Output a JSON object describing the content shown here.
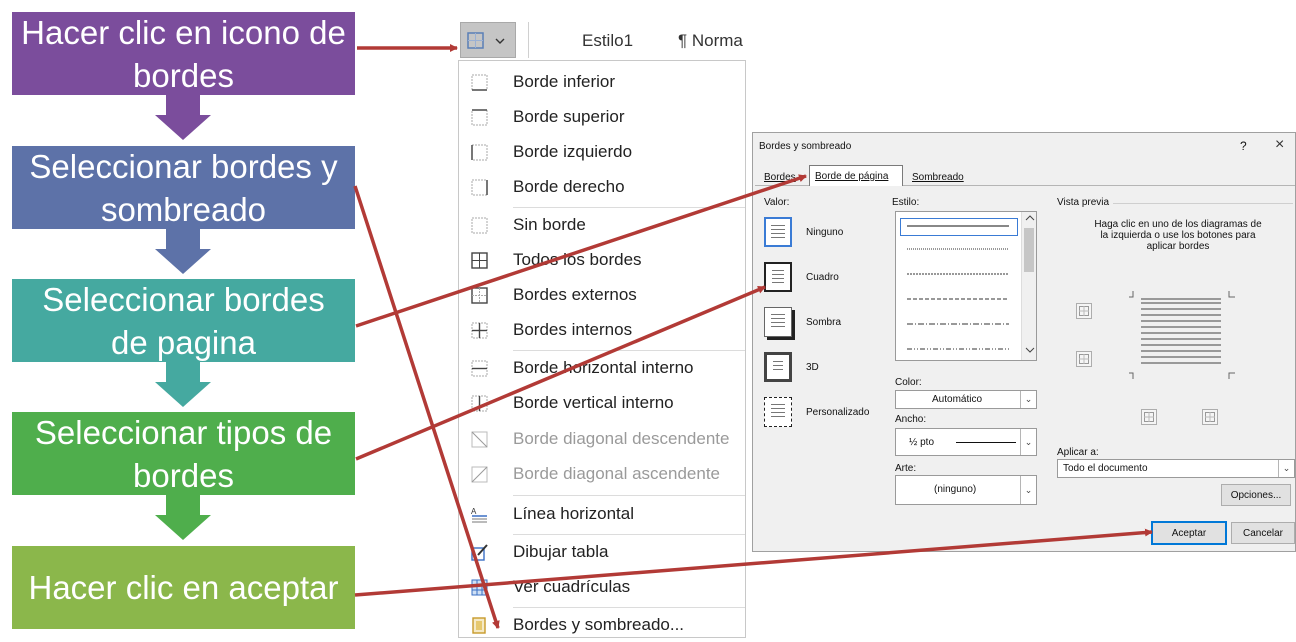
{
  "steps": [
    {
      "label": "Hacer clic en icono de bordes",
      "color": "#7b4d9c"
    },
    {
      "label": "Seleccionar bordes y sombreado",
      "color": "#5d72a8"
    },
    {
      "label": "Seleccionar bordes de pagina",
      "color": "#45a9a0"
    },
    {
      "label": "Seleccionar tipos de bordes",
      "color": "#4fae4c"
    },
    {
      "label": "Hacer clic en aceptar",
      "color": "#8bb74b"
    }
  ],
  "toolbar": {
    "style1": "Estilo1",
    "normal": "¶ Norma"
  },
  "menu": {
    "items": [
      {
        "label": "Borde inferior",
        "icon": "border-bottom-icon"
      },
      {
        "label": "Borde superior",
        "icon": "border-top-icon"
      },
      {
        "label": "Borde izquierdo",
        "icon": "border-left-icon"
      },
      {
        "label": "Borde derecho",
        "icon": "border-right-icon"
      },
      {
        "label": "Sin borde",
        "icon": "no-border-icon"
      },
      {
        "label": "Todos los bordes",
        "icon": "all-borders-icon"
      },
      {
        "label": "Bordes externos",
        "icon": "outside-borders-icon"
      },
      {
        "label": "Bordes internos",
        "icon": "inside-borders-icon"
      },
      {
        "label": "Borde horizontal interno",
        "icon": "inside-horizontal-border-icon"
      },
      {
        "label": "Borde vertical interno",
        "icon": "inside-vertical-border-icon"
      },
      {
        "label": "Borde diagonal descendente",
        "icon": "diagonal-down-border-icon"
      },
      {
        "label": "Borde diagonal ascendente",
        "icon": "diagonal-up-border-icon"
      },
      {
        "label": "Línea horizontal",
        "icon": "horizontal-line-icon"
      },
      {
        "label": "Dibujar tabla",
        "icon": "draw-table-icon"
      },
      {
        "label": "Ver cuadrículas",
        "icon": "view-gridlines-icon"
      },
      {
        "label": "Bordes y sombreado...",
        "icon": "borders-shading-icon"
      }
    ]
  },
  "dialog": {
    "title": "Bordes y sombreado",
    "help": "?",
    "close": "×",
    "tabs": [
      "Bordes",
      "Borde de página",
      "Sombreado"
    ],
    "valor_label": "Valor:",
    "settings": [
      "Ninguno",
      "Cuadro",
      "Sombra",
      "3D",
      "Personalizado"
    ],
    "estilo_label": "Estilo:",
    "color_label": "Color:",
    "color_value": "Automático",
    "ancho_label": "Ancho:",
    "ancho_value": "½ pto",
    "arte_label": "Arte:",
    "arte_value": "(ninguno)",
    "preview_label": "Vista previa",
    "preview_hint": "Haga clic en uno de los diagramas de la izquierda o use los botones para aplicar bordes",
    "aplicar_label": "Aplicar a:",
    "aplicar_value": "Todo el documento",
    "opciones_button": "Opciones...",
    "accept_button": "Aceptar",
    "cancel_button": "Cancelar"
  },
  "colors": {
    "arrow": "#b23a36",
    "dialog_bg": "#f0f0f0",
    "accent": "#0078d7"
  }
}
